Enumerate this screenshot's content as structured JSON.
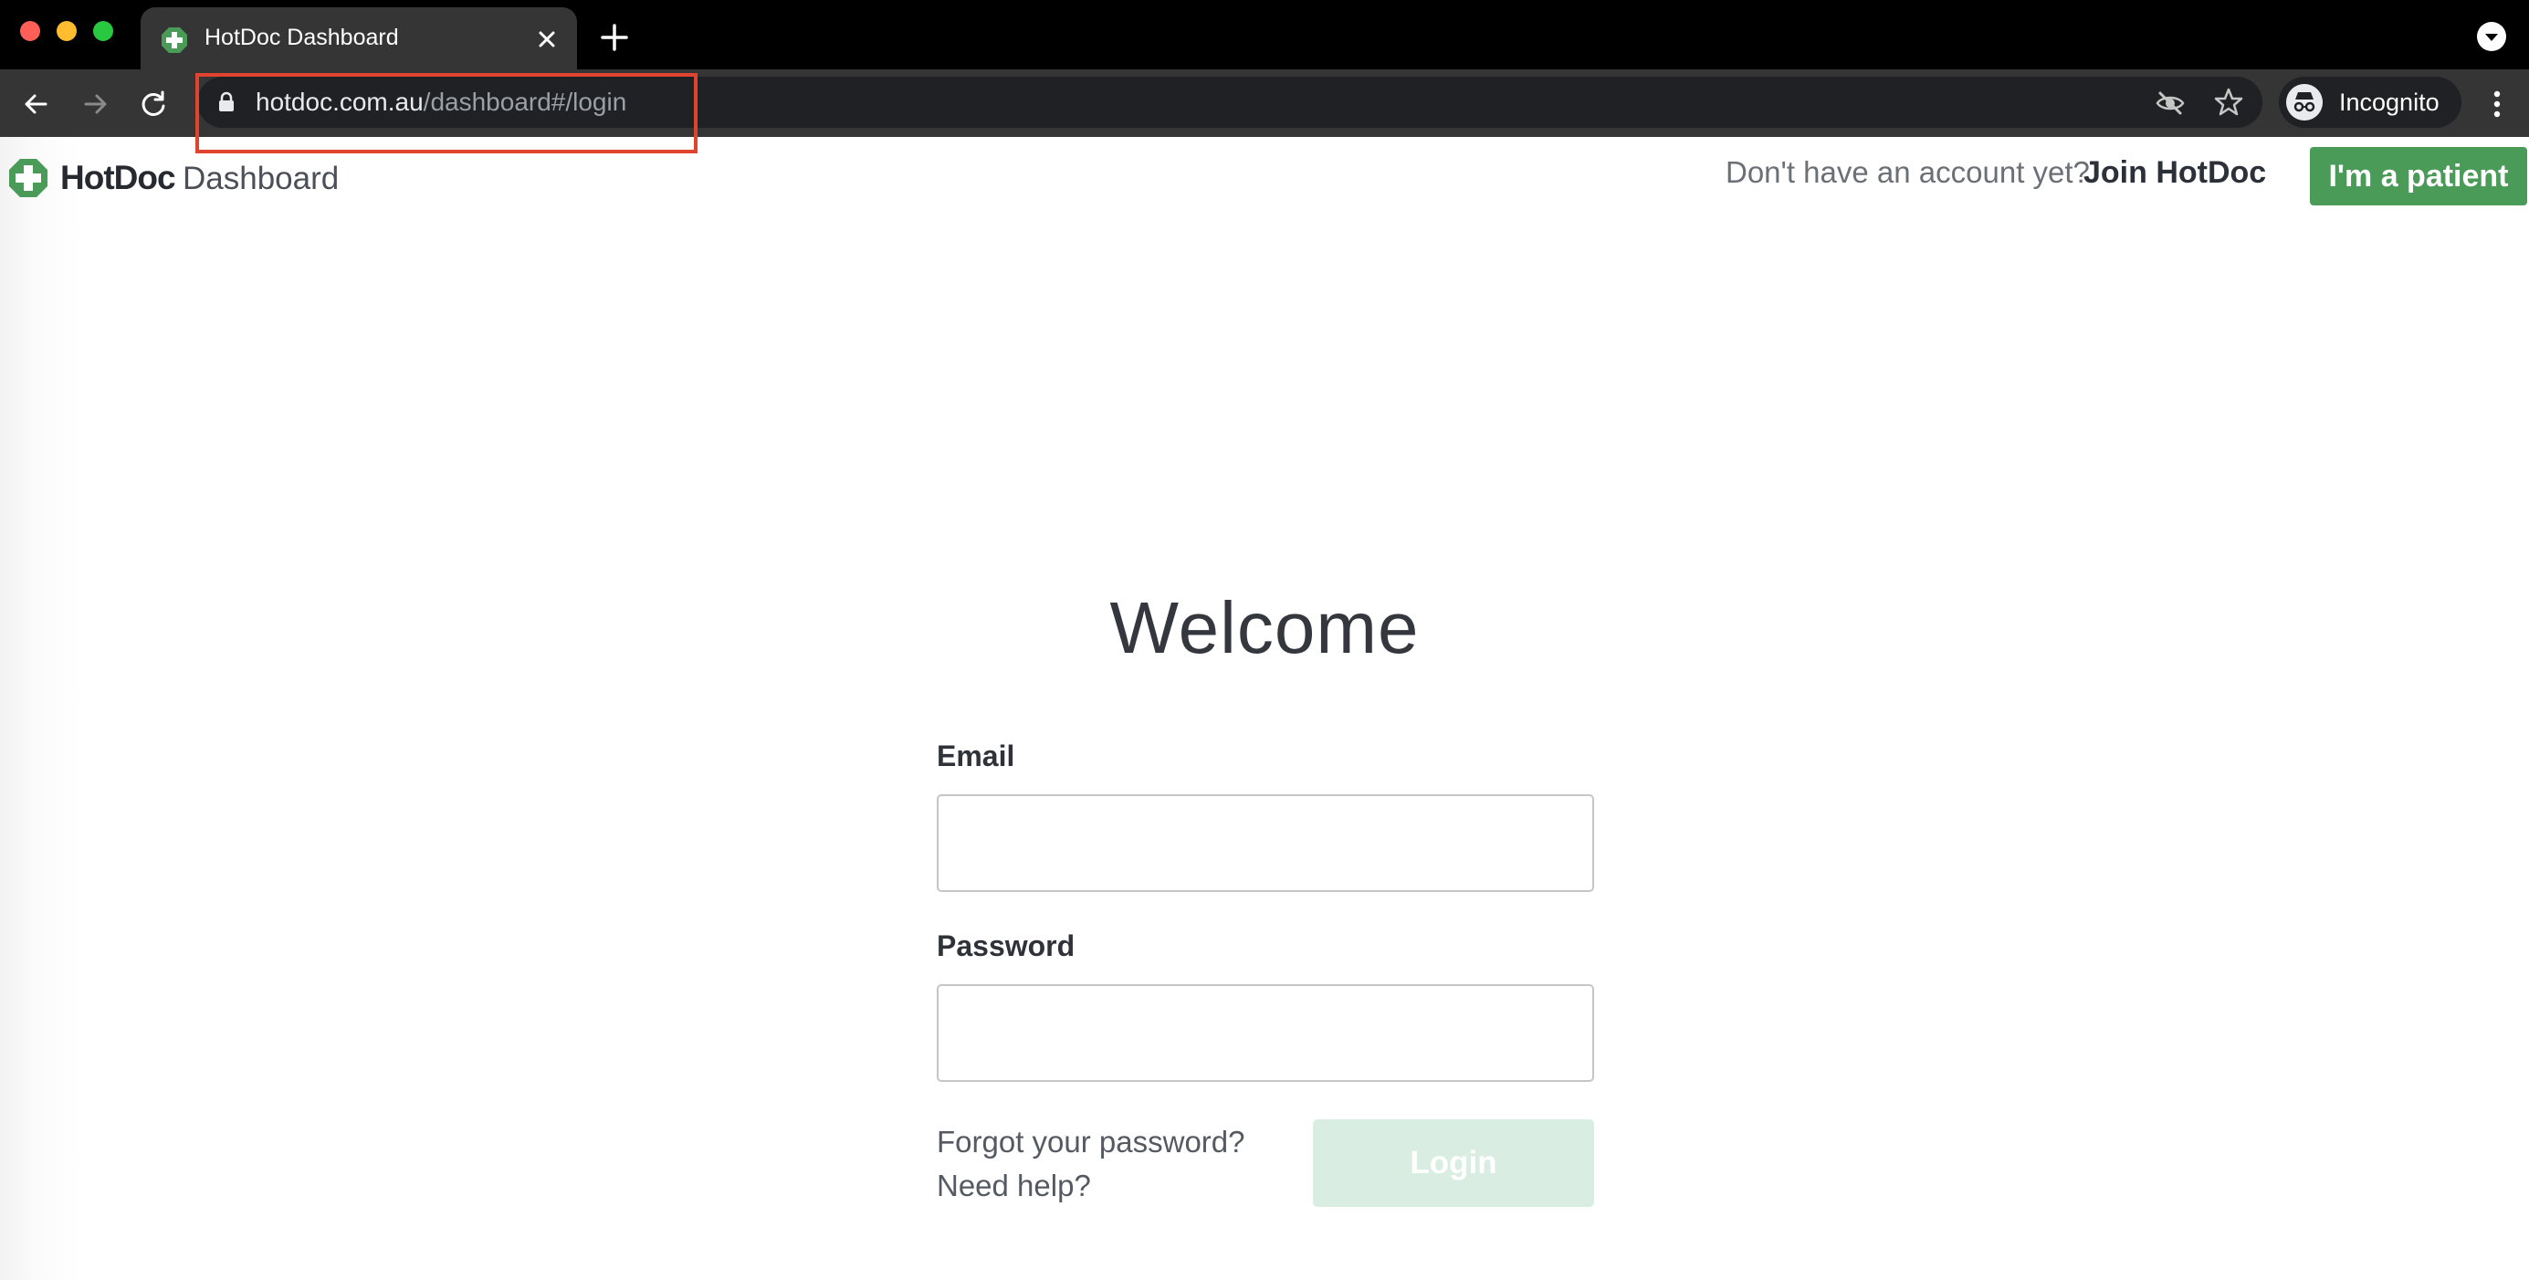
{
  "browser": {
    "tab_title": "HotDoc Dashboard",
    "url_host": "hotdoc.com.au",
    "url_path": "/dashboard#/login",
    "profile_label": "Incognito",
    "icons": [
      "back-arrow-icon",
      "forward-arrow-icon",
      "reload-icon",
      "lock-icon",
      "eye-slash-icon",
      "star-icon",
      "incognito-icon",
      "more-vert-icon",
      "tab-search-icon",
      "close-icon",
      "plus-icon"
    ]
  },
  "header": {
    "brand": "HotDoc",
    "product": "Dashboard",
    "account_prompt": "Don't have an account yet?",
    "join_link": "Join HotDoc",
    "patient_button": "I'm a patient"
  },
  "login": {
    "heading": "Welcome",
    "email_label": "Email",
    "email_value": "",
    "password_label": "Password",
    "password_value": "",
    "forgot_link": "Forgot your password?",
    "help_link": "Need help?",
    "login_button": "Login"
  },
  "colors": {
    "brand_green": "#4a9a58",
    "login_disabled": "#d9ede2",
    "highlight": "#e0442e"
  }
}
